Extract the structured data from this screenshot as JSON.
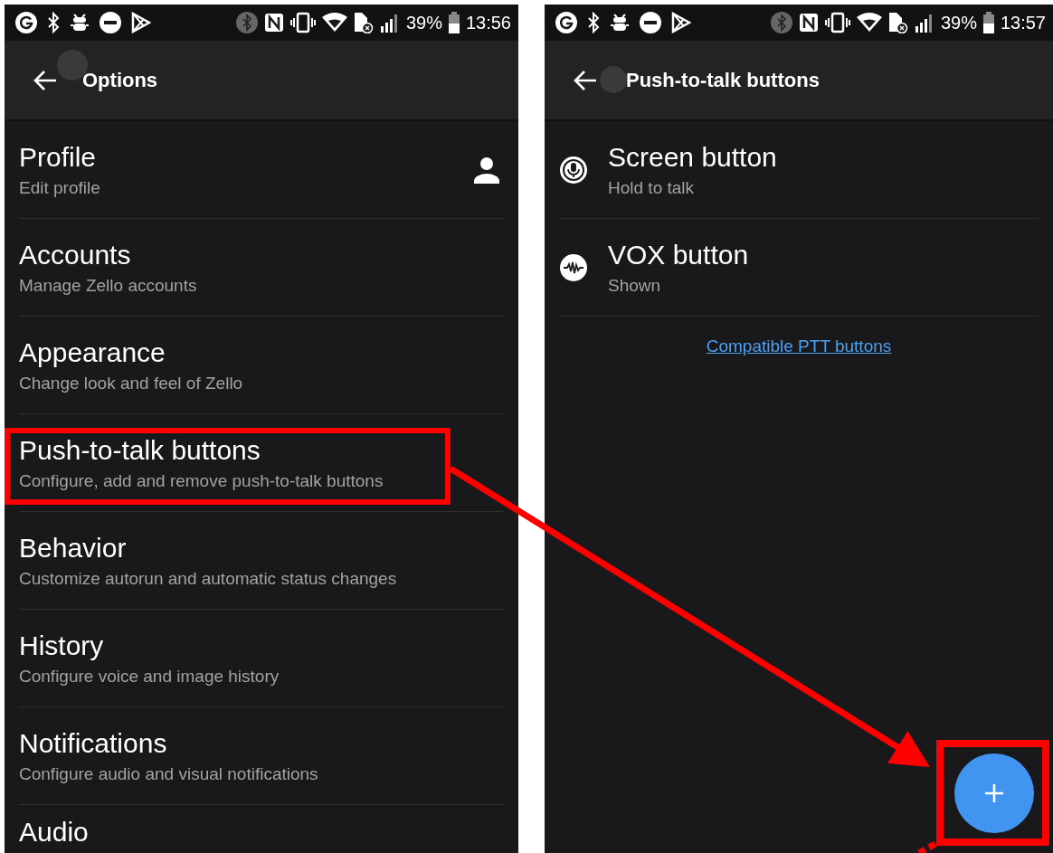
{
  "screens": [
    {
      "status_bar": {
        "battery": "39%",
        "time": "13:56"
      },
      "app_bar": {
        "title": "Options"
      },
      "items": [
        {
          "title": "Profile",
          "subtitle": "Edit profile",
          "highlighted": false
        },
        {
          "title": "Accounts",
          "subtitle": "Manage Zello accounts",
          "highlighted": false
        },
        {
          "title": "Appearance",
          "subtitle": "Change look and feel of Zello",
          "highlighted": false
        },
        {
          "title": "Push-to-talk buttons",
          "subtitle": "Configure, add and remove push-to-talk buttons",
          "highlighted": true
        },
        {
          "title": "Behavior",
          "subtitle": "Customize autorun and automatic status changes",
          "highlighted": false
        },
        {
          "title": "History",
          "subtitle": "Configure voice and image history",
          "highlighted": false
        },
        {
          "title": "Notifications",
          "subtitle": "Configure audio and visual notifications",
          "highlighted": false
        },
        {
          "title": "Audio",
          "highlighted": false
        }
      ]
    },
    {
      "status_bar": {
        "battery": "39%",
        "time": "13:57"
      },
      "app_bar": {
        "title": "Push-to-talk buttons"
      },
      "items": [
        {
          "title": "Screen button",
          "subtitle": "Hold to talk",
          "highlighted": false
        },
        {
          "title": "VOX button",
          "subtitle": "Shown",
          "highlighted": false
        }
      ],
      "link": "Compatible PTT buttons",
      "fab": {
        "highlighted": true
      }
    }
  ]
}
